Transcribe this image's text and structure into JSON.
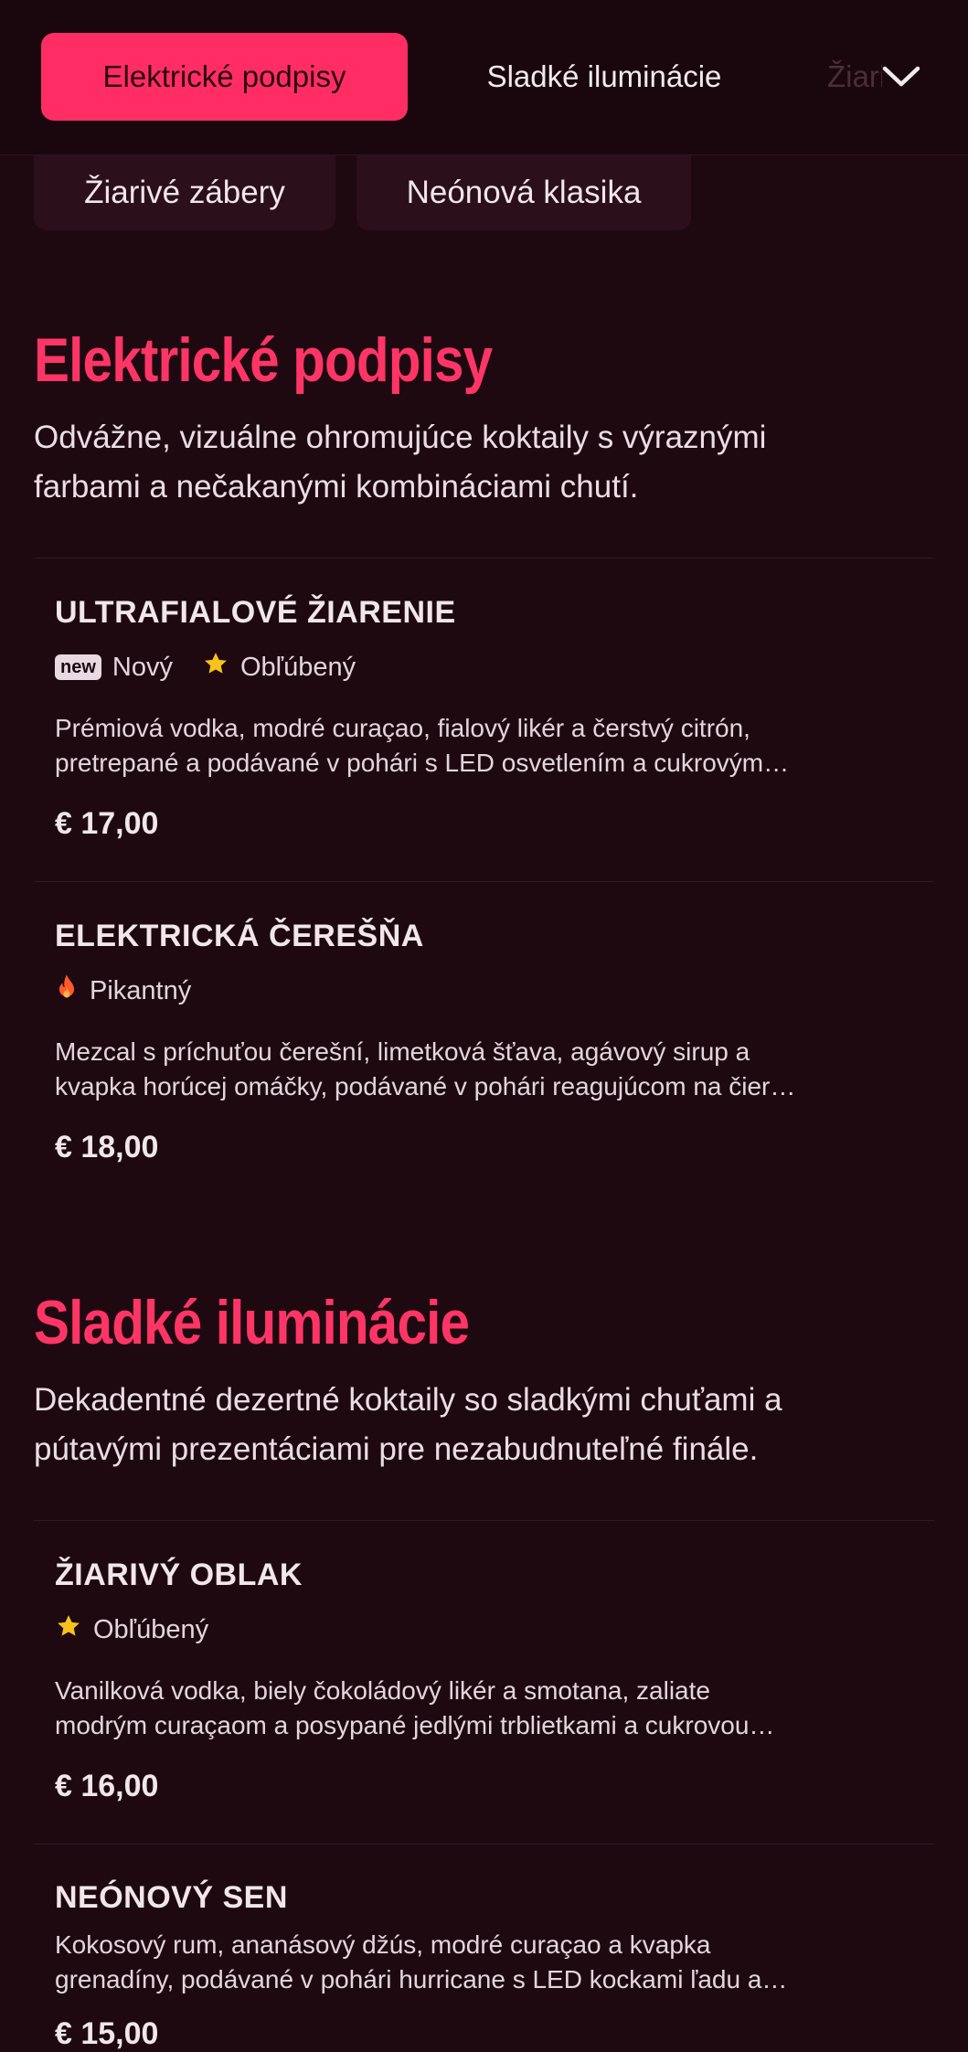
{
  "nav": {
    "tabs": [
      {
        "label": "Elektrické podpisy",
        "active": true
      },
      {
        "label": "Sladké iluminácie",
        "active": false
      },
      {
        "label": "Žiarivé zábery",
        "active": false
      }
    ],
    "expand_icon": "chevron-down-icon",
    "chips": [
      "Žiarivé zábery",
      "Neónová klasika"
    ]
  },
  "sections": [
    {
      "title": "Elektrické podpisy",
      "description_line1": "Odvážne, vizuálne ohromujúce koktaily s výraznými",
      "description_line2": "farbami a nečakanými kombináciami chutí.",
      "items": [
        {
          "name": "ULTRAFIALOVÉ ŽIARENIE",
          "badge": "new",
          "tag1": "Nový",
          "tag2": "Obľúbený",
          "desc_line1": "Prémiová vodka, modré curaçao, fialový likér a čerstvý citrón,",
          "desc_line2": "pretrepané a podávané v pohári s LED osvetlením a cukrovým…",
          "price": "€ 17,00"
        },
        {
          "name": "ELEKTRICKÁ ČEREŠŇA",
          "tag1": "Pikantný",
          "desc_line1": "Mezcal s príchuťou čerešní, limetková šťava, agávový sirup a",
          "desc_line2": "kvapka horúcej omáčky, podávané v pohári reagujúcom na čier…",
          "price": "€ 18,00"
        }
      ]
    },
    {
      "title": "Sladké iluminácie",
      "description_line1": "Dekadentné dezertné koktaily so sladkými chuťami a",
      "description_line2": "pútavými prezentáciami pre nezabudnuteľné finále.",
      "items": [
        {
          "name": "ŽIARIVÝ OBLAK",
          "tag1": "Obľúbený",
          "desc_line1": "Vanilková vodka, biely čokoládový likér a smotana, zaliate",
          "desc_line2": "modrým curaçaom a posypané jedlými trblietkami a cukrovou…",
          "price": "€ 16,00"
        },
        {
          "name": "NEÓNOVÝ SEN",
          "desc_line1": "Kokosový rum, ananásový džús, modré curaçao a kvapka",
          "desc_line2": "grenadíny, podávané v pohári hurricane s LED kockami ľadu a…",
          "price": "€ 15,00"
        }
      ]
    }
  ],
  "colors": {
    "background": "#1e0911",
    "accent": "#ff2d63",
    "star": "#f7c21b",
    "flame": "#ff5a2a"
  }
}
